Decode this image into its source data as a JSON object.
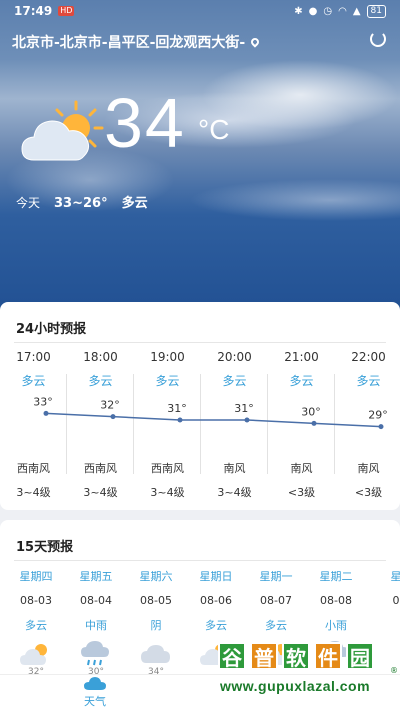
{
  "status_bar": {
    "time": "17:49",
    "badge": "HD",
    "battery": "81"
  },
  "location": {
    "text": "北京市-北京市-昌平区-回龙观西大街-"
  },
  "current": {
    "temp": "34",
    "unit": "°C",
    "today_label": "今天",
    "range": "33~26°",
    "condition": "多云"
  },
  "hourly": {
    "title": "24小时预报",
    "items": [
      {
        "time": "17:00",
        "cond": "多云",
        "temp": "33°",
        "t": 33,
        "wind": "西南风",
        "level": "3~4级"
      },
      {
        "time": "18:00",
        "cond": "多云",
        "temp": "32°",
        "t": 32,
        "wind": "西南风",
        "level": "3~4级"
      },
      {
        "time": "19:00",
        "cond": "多云",
        "temp": "31°",
        "t": 31,
        "wind": "西南风",
        "level": "3~4级"
      },
      {
        "time": "20:00",
        "cond": "多云",
        "temp": "31°",
        "t": 31,
        "wind": "南风",
        "level": "3~4级"
      },
      {
        "time": "21:00",
        "cond": "多云",
        "temp": "30°",
        "t": 30,
        "wind": "南风",
        "level": "<3级"
      },
      {
        "time": "22:00",
        "cond": "多云",
        "temp": "29°",
        "t": 29,
        "wind": "南风",
        "level": "<3级"
      }
    ]
  },
  "daily": {
    "title": "15天预报",
    "items": [
      {
        "weekday": "星期四",
        "date": "08-03",
        "cond": "多云",
        "hi": "32°",
        "icon": "sun-cloud"
      },
      {
        "weekday": "星期五",
        "date": "08-04",
        "cond": "中雨",
        "hi": "30°",
        "icon": "rain"
      },
      {
        "weekday": "星期六",
        "date": "08-05",
        "cond": "阴",
        "hi": "34°",
        "icon": "cloud"
      },
      {
        "weekday": "星期日",
        "date": "08-06",
        "cond": "多云",
        "hi": "",
        "icon": "sun-cloud"
      },
      {
        "weekday": "星期一",
        "date": "08-07",
        "cond": "多云",
        "hi": "",
        "icon": "sun-cloud"
      },
      {
        "weekday": "星期二",
        "date": "08-08",
        "cond": "小雨",
        "hi": "",
        "icon": "rain"
      },
      {
        "weekday": "星",
        "date": "0",
        "cond": "",
        "hi": "",
        "icon": ""
      }
    ]
  },
  "bottom_nav": {
    "tab_weather": "天气"
  },
  "watermark": {
    "brand": "谷普软件园",
    "url": "www.gupuxlazal.com",
    "reg": "®"
  },
  "colors": {
    "accent": "#3aa0d8",
    "line": "#4a6fa8"
  }
}
